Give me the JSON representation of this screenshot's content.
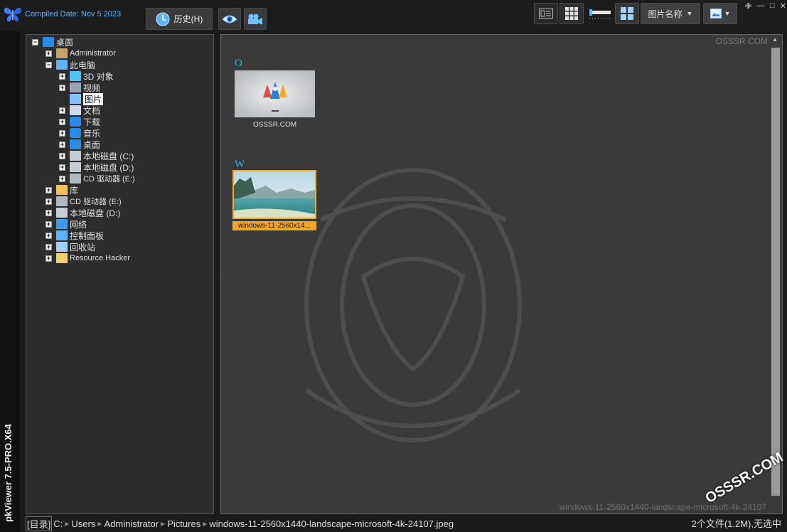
{
  "app": {
    "compiled": "Compiled Date: Nov  5 2023",
    "vertical_title": "pkViewer 7.5-PRO.X64"
  },
  "toolbar": {
    "history_label": "历史(H)",
    "sort_label": "图片名称"
  },
  "tree": {
    "items": [
      {
        "label": "桌面",
        "level": 0,
        "expander": "minus",
        "icon": "desktop-icon"
      },
      {
        "label": "Administrator",
        "level": 1,
        "expander": "plus",
        "icon": "user-icon"
      },
      {
        "label": "此电脑",
        "level": 1,
        "expander": "minus",
        "icon": "computer-icon"
      },
      {
        "label": "3D 对象",
        "level": 2,
        "expander": "plus",
        "icon": "cube-icon"
      },
      {
        "label": "视频",
        "level": 2,
        "expander": "plus",
        "icon": "video-icon"
      },
      {
        "label": "图片",
        "level": 2,
        "expander": "none",
        "icon": "pictures-icon",
        "selected": true
      },
      {
        "label": "文档",
        "level": 2,
        "expander": "plus",
        "icon": "document-icon"
      },
      {
        "label": "下载",
        "level": 2,
        "expander": "plus",
        "icon": "download-icon"
      },
      {
        "label": "音乐",
        "level": 2,
        "expander": "plus",
        "icon": "music-icon"
      },
      {
        "label": "桌面",
        "level": 2,
        "expander": "plus",
        "icon": "desktop-icon"
      },
      {
        "label": "本地磁盘 (C:)",
        "level": 2,
        "expander": "plus",
        "icon": "drive-icon"
      },
      {
        "label": "本地磁盘 (D:)",
        "level": 2,
        "expander": "plus",
        "icon": "drive-icon"
      },
      {
        "label": "CD 驱动器 (E:)",
        "level": 2,
        "expander": "plus",
        "icon": "cd-drive-icon"
      },
      {
        "label": "库",
        "level": 1,
        "expander": "plus",
        "icon": "library-icon"
      },
      {
        "label": "CD 驱动器 (E:)",
        "level": 1,
        "expander": "plus",
        "icon": "cd-drive-icon"
      },
      {
        "label": "本地磁盘 (D:)",
        "level": 1,
        "expander": "plus",
        "icon": "drive-icon"
      },
      {
        "label": "网络",
        "level": 1,
        "expander": "plus",
        "icon": "network-icon"
      },
      {
        "label": "控制面板",
        "level": 1,
        "expander": "plus",
        "icon": "control-panel-icon"
      },
      {
        "label": "回收站",
        "level": 1,
        "expander": "plus",
        "icon": "recycle-bin-icon"
      },
      {
        "label": "Resource Hacker",
        "level": 1,
        "expander": "plus",
        "icon": "folder-icon"
      }
    ]
  },
  "content": {
    "watermark": "OSSSR.COM",
    "groups": [
      {
        "letter": "O",
        "caption": "OSSSR.COM",
        "selected": false
      },
      {
        "letter": "W",
        "caption": "windows-11-2560x14...",
        "selected": true
      }
    ],
    "file_watermark": "windows-11-2560x1440-landscape-microsoft-4k-24107"
  },
  "status": {
    "dir_label": "[目录]",
    "path": [
      "C:",
      "Users",
      "Administrator",
      "Pictures",
      "windows-11-2560x1440-landscape-microsoft-4k-24107.jpeg"
    ],
    "count": "2个文件(1.2M),无选中"
  },
  "corner_watermark": "OSSSR.COM",
  "colors": {
    "accent_blue": "#1fb6d8",
    "selection_orange": "#f5a623",
    "panel_bg": "#3a3a3a"
  }
}
